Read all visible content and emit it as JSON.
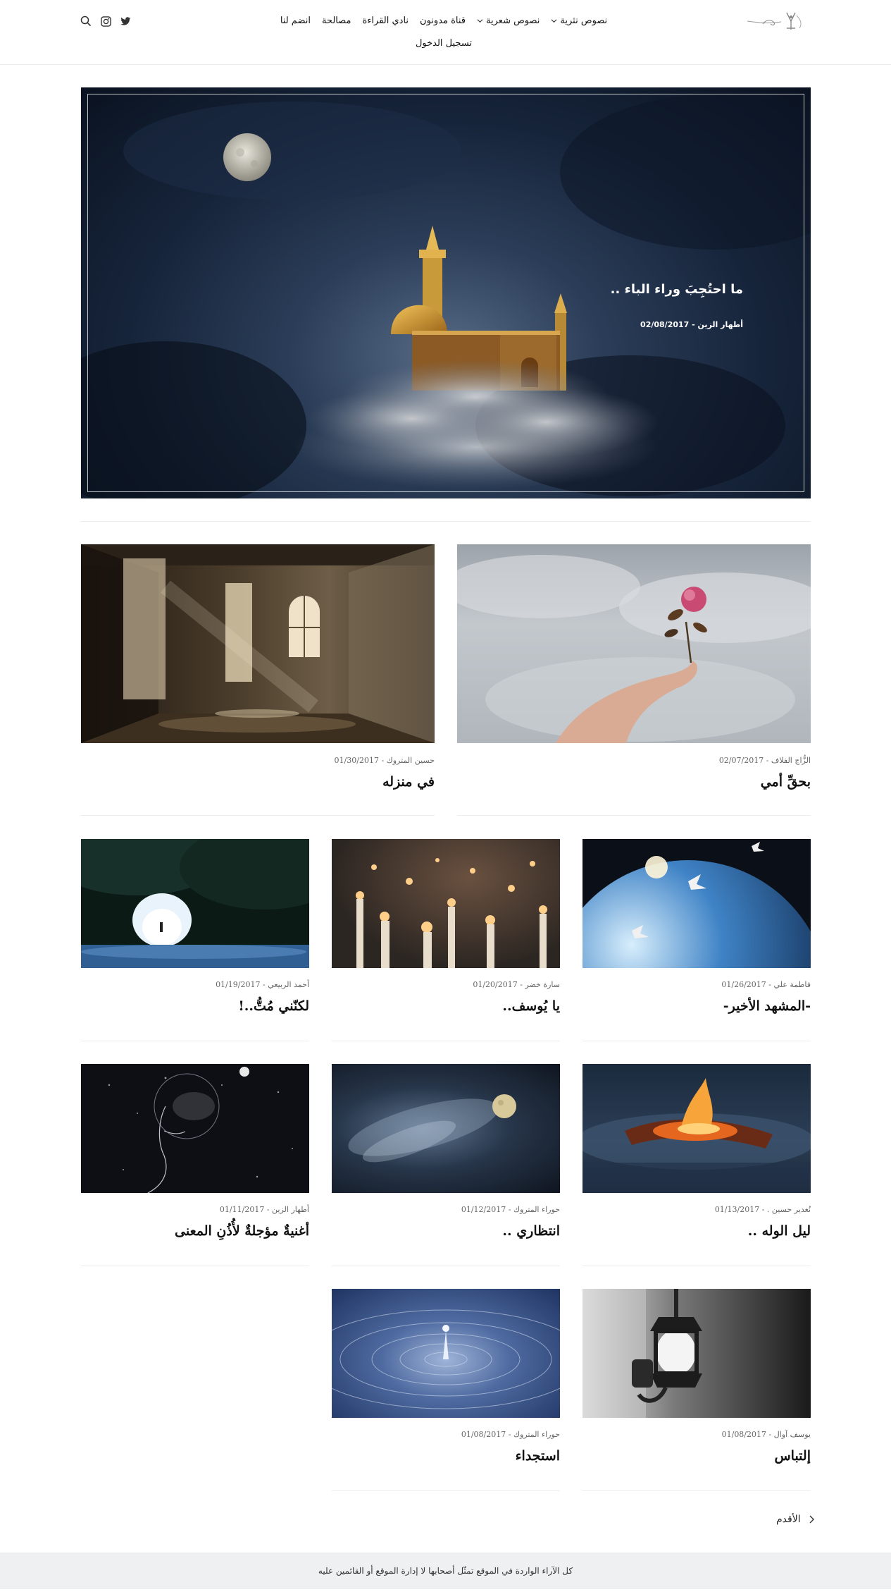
{
  "nav": {
    "items": [
      {
        "label": "نصوص نثرية",
        "has_dropdown": true
      },
      {
        "label": "نصوص شعرية",
        "has_dropdown": true
      },
      {
        "label": "قناة مدونون",
        "has_dropdown": false
      },
      {
        "label": "نادي القراءة",
        "has_dropdown": false
      },
      {
        "label": "مصالحة",
        "has_dropdown": false
      },
      {
        "label": "انضم لنا",
        "has_dropdown": false
      }
    ],
    "login": "تسجيل الدخول"
  },
  "header_icons": [
    "search-icon",
    "instagram-icon",
    "twitter-icon"
  ],
  "hero": {
    "title": "ما احتُجِبَ وراء الباء ..",
    "meta": "أطهار الزين - 02/08/2017"
  },
  "posts": [
    {
      "title": "بحقِّ أمي",
      "meta": "الزُّاج الفلاف - 02/07/2017",
      "image": "hand-holding-rose"
    },
    {
      "title": "في منزله",
      "meta": "حسين المتروك - 01/30/2017",
      "image": "abandoned-room-windows"
    },
    {
      "title": "-المشهد الأخير-",
      "meta": "فاطمة علي - 01/26/2017",
      "image": "doves-over-earth"
    },
    {
      "title": "يا يُوسف..",
      "meta": "سارة خضر - 01/20/2017",
      "image": "candles"
    },
    {
      "title": "لكنّني مُتُّ..!",
      "meta": "أحمد الربيعي - 01/19/2017",
      "image": "light-tunnel"
    },
    {
      "title": "ليل الوله ..",
      "meta": "نُغدير حسين . - 01/13/2017",
      "image": "burning-embers"
    },
    {
      "title": "انتظاري ..",
      "meta": "حوراء المتروك - 01/12/2017",
      "image": "moon-clouds"
    },
    {
      "title": "أغنيةٌ مؤجلةٌ لأُذُنِ المعنى",
      "meta": "أطهار الزين - 01/11/2017",
      "image": "cosmic-face"
    },
    {
      "title": "إلتباس",
      "meta": "يوسف آوال - 01/08/2017",
      "image": "lantern"
    },
    {
      "title": "استجداء",
      "meta": "حوراء المتروك - 01/08/2017",
      "image": "water-drop"
    }
  ],
  "pagination": {
    "older_label": "الأقدم"
  },
  "footer": {
    "text": "كل الآراء الواردة في الموقع تمثّل أصحابها لا إدارة الموقع أو القائمين عليه"
  },
  "colors": {
    "accent": "#111111",
    "footer_bg": "#eef0f2",
    "divider": "#ececec"
  }
}
